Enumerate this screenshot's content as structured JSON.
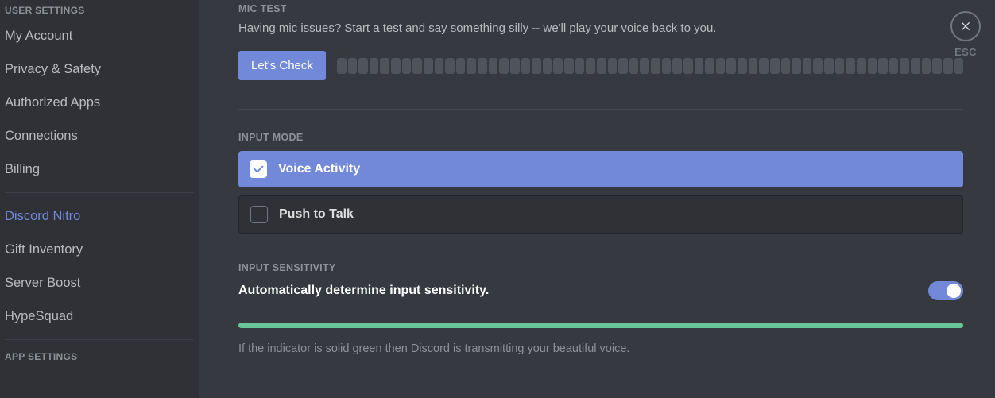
{
  "sidebar": {
    "header1": "USER SETTINGS",
    "items1": [
      "My Account",
      "Privacy & Safety",
      "Authorized Apps",
      "Connections",
      "Billing"
    ],
    "items2": [
      "Discord Nitro",
      "Gift Inventory",
      "Server Boost",
      "HypeSquad"
    ],
    "header2": "APP SETTINGS"
  },
  "mic": {
    "header": "MIC TEST",
    "desc": "Having mic issues? Start a test and say something silly -- we'll play your voice back to you.",
    "button": "Let's Check"
  },
  "input_mode": {
    "header": "INPUT MODE",
    "opt1": "Voice Activity",
    "opt2": "Push to Talk"
  },
  "sensitivity": {
    "header": "INPUT SENSITIVITY",
    "auto_label": "Automatically determine input sensitivity.",
    "note": "If the indicator is solid green then Discord is transmitting your beautiful voice."
  },
  "close": {
    "esc": "ESC"
  }
}
